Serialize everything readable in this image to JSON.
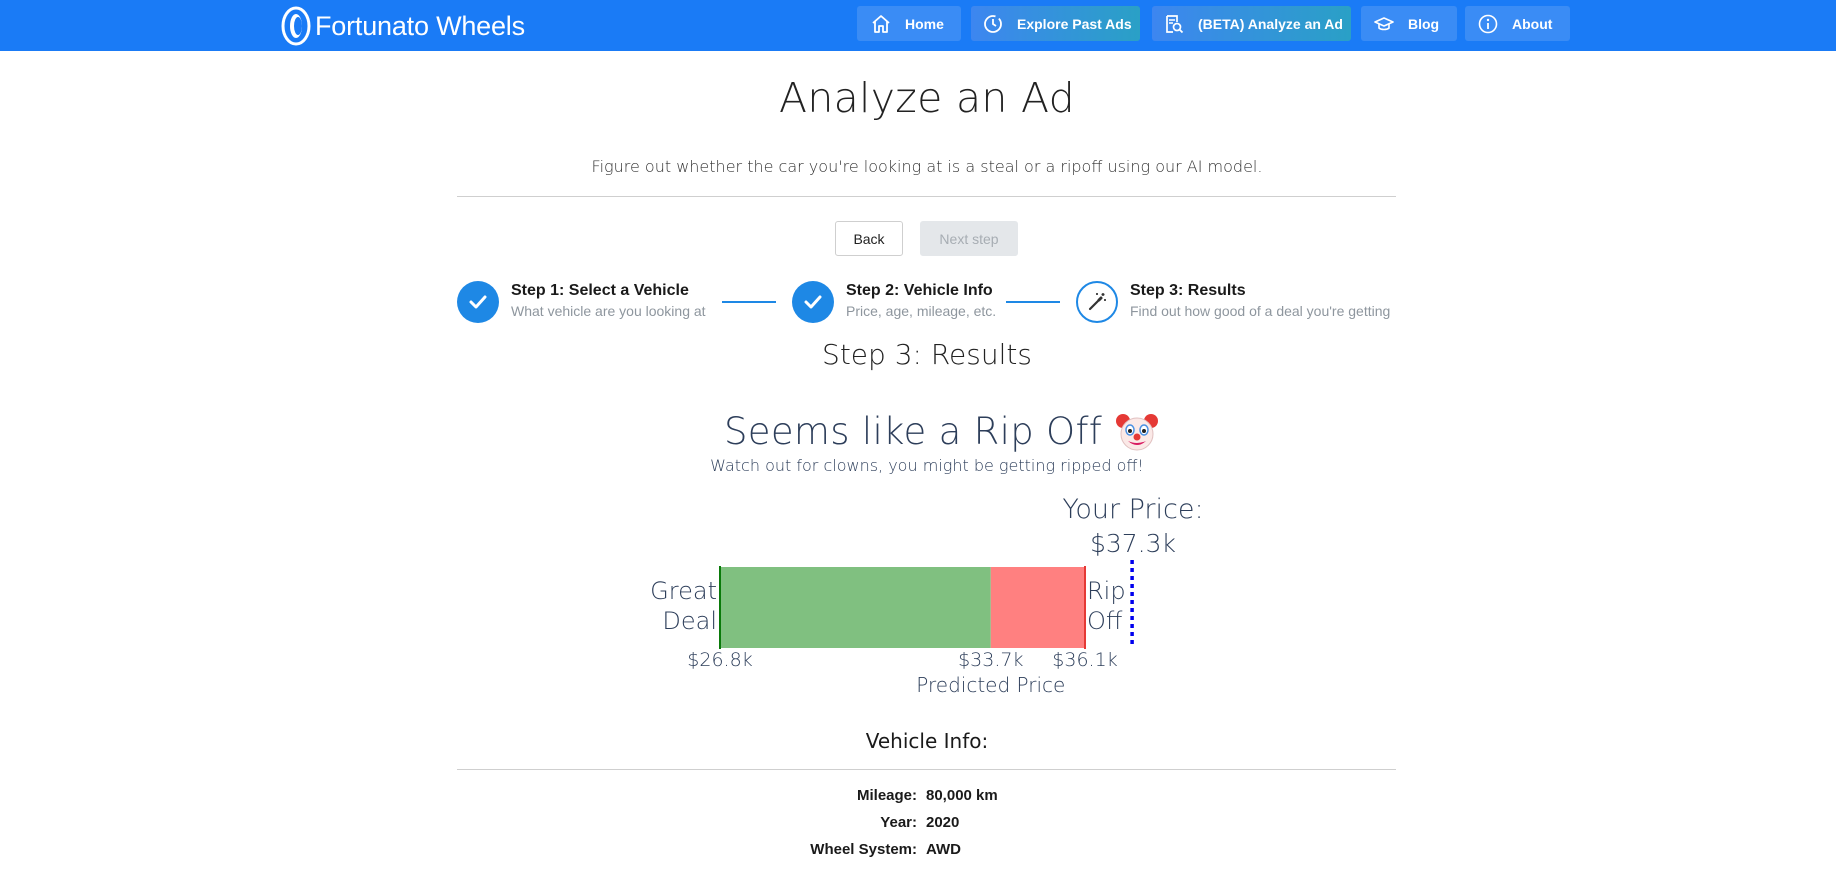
{
  "navbar": {
    "brand": "Fortunato Wheels",
    "items": [
      {
        "label": "Home",
        "icon": "home-icon"
      },
      {
        "label": "Explore Past Ads",
        "icon": "history-icon"
      },
      {
        "label": "(BETA) Analyze an Ad",
        "icon": "document-search-icon"
      },
      {
        "label": "Blog",
        "icon": "graduation-cap-icon"
      },
      {
        "label": "About",
        "icon": "info-icon"
      }
    ],
    "color": "#1a7bf6"
  },
  "header": {
    "title": "Analyze an Ad",
    "subtitle": "Figure out whether the car you're looking at is a steal or a ripoff using our AI model."
  },
  "controls": {
    "back_label": "Back",
    "next_label": "Next step"
  },
  "stepper": {
    "steps": [
      {
        "label": "Step 1: Select a Vehicle",
        "desc": "What vehicle are you looking at",
        "state": "done"
      },
      {
        "label": "Step 2: Vehicle Info",
        "desc": "Price, age, mileage, etc.",
        "state": "done"
      },
      {
        "label": "Step 3: Results",
        "desc": "Find out how good of a deal you're getting",
        "state": "current"
      }
    ],
    "accent": "#1e88e5"
  },
  "results": {
    "title": "Step 3: Results",
    "verdict": "Seems like a Rip Off",
    "verdict_icon": "clown-face-icon",
    "verdict_sub": "Watch out for clowns, you might be getting ripped off!"
  },
  "price_gauge": {
    "your_price_label": "Your Price:",
    "your_price": "$37.3k",
    "left_label_line1": "Great",
    "left_label_line2": "Deal",
    "right_label_line1": "Rip",
    "right_label_line2": "Off",
    "low": "$26.8k",
    "predicted": "$33.7k",
    "high": "$36.1k",
    "predicted_label": "Predicted Price",
    "low_value": 26.8,
    "predicted_value": 33.7,
    "high_value": 36.1,
    "your_value": 37.3,
    "good_color": "#80c080",
    "bad_color": "#ff8080",
    "marker_color": "#0000ee"
  },
  "vehicle_info": {
    "title": "Vehicle Info:",
    "rows": [
      {
        "key": "Mileage:",
        "value": "80,000 km"
      },
      {
        "key": "Year:",
        "value": "2020"
      },
      {
        "key": "Wheel System:",
        "value": "AWD"
      }
    ]
  }
}
